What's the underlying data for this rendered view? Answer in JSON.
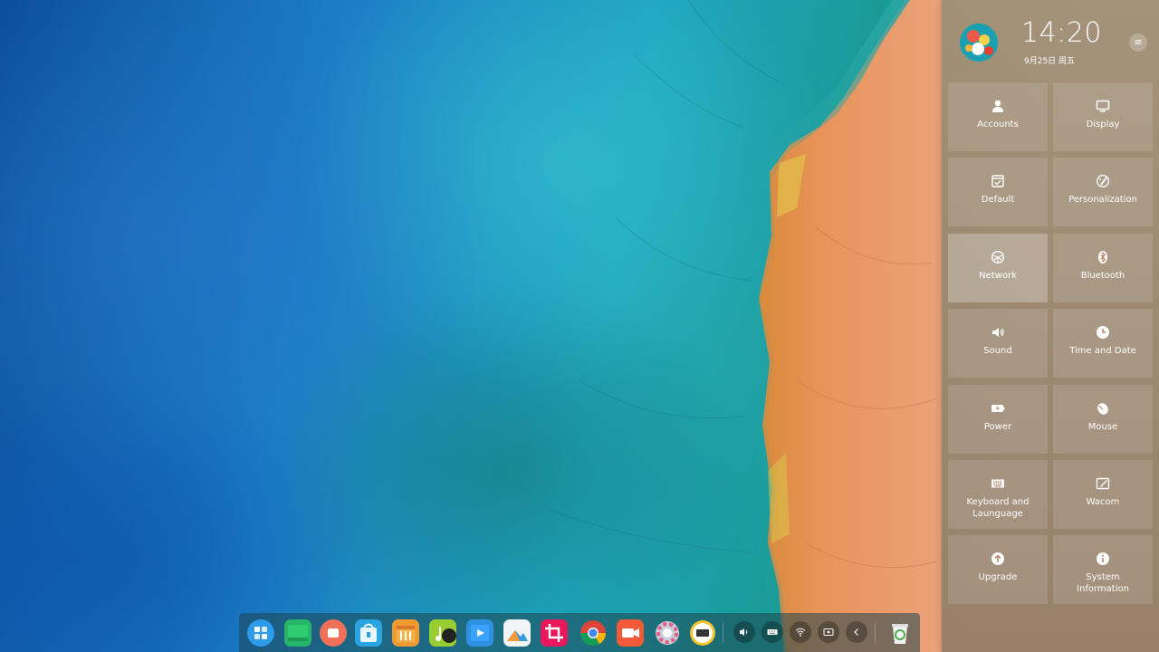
{
  "clock": {
    "time": "14:20",
    "date": "9月25日  周五"
  },
  "menu": {
    "glyph": "≡"
  },
  "settings_tiles": [
    {
      "label": "Accounts",
      "icon": "user-icon"
    },
    {
      "label": "Display",
      "icon": "monitor-icon"
    },
    {
      "label": "Default",
      "icon": "default-apps-icon"
    },
    {
      "label": "Personalization",
      "icon": "palette-icon"
    },
    {
      "label": "Network",
      "icon": "network-icon",
      "active": true
    },
    {
      "label": "Bluetooth",
      "icon": "bluetooth-icon"
    },
    {
      "label": "Sound",
      "icon": "speaker-icon"
    },
    {
      "label": "Time and Date",
      "icon": "clock-icon"
    },
    {
      "label": "Power",
      "icon": "battery-icon"
    },
    {
      "label": "Mouse",
      "icon": "mouse-icon"
    },
    {
      "label": "Keyboard and Launguage",
      "icon": "keyboard-icon"
    },
    {
      "label": "Wacom",
      "icon": "tablet-pen-icon"
    },
    {
      "label": "Upgrade",
      "icon": "upgrade-arrow-icon"
    },
    {
      "label": "System Information",
      "icon": "info-icon"
    }
  ],
  "dock": {
    "apps": [
      "launcher-icon",
      "file-manager-icon",
      "screen-recorder-icon",
      "app-store-icon",
      "archive-manager-icon",
      "music-icon",
      "movie-icon",
      "image-viewer-icon",
      "screenshot-crop-icon",
      "chrome-icon",
      "video-call-icon",
      "control-center-icon",
      "clock-app-icon"
    ],
    "tray": [
      "volume-icon",
      "keyboard-layout-icon",
      "wifi-icon",
      "screen-icon",
      "collapse-arrow-icon"
    ],
    "trash": "trash-icon"
  },
  "colors": {
    "panel": "#bf8c6e",
    "sea_deep": "#0c4f9c",
    "sea_shallow": "#1ea5c0",
    "sand": "#e8894a"
  }
}
